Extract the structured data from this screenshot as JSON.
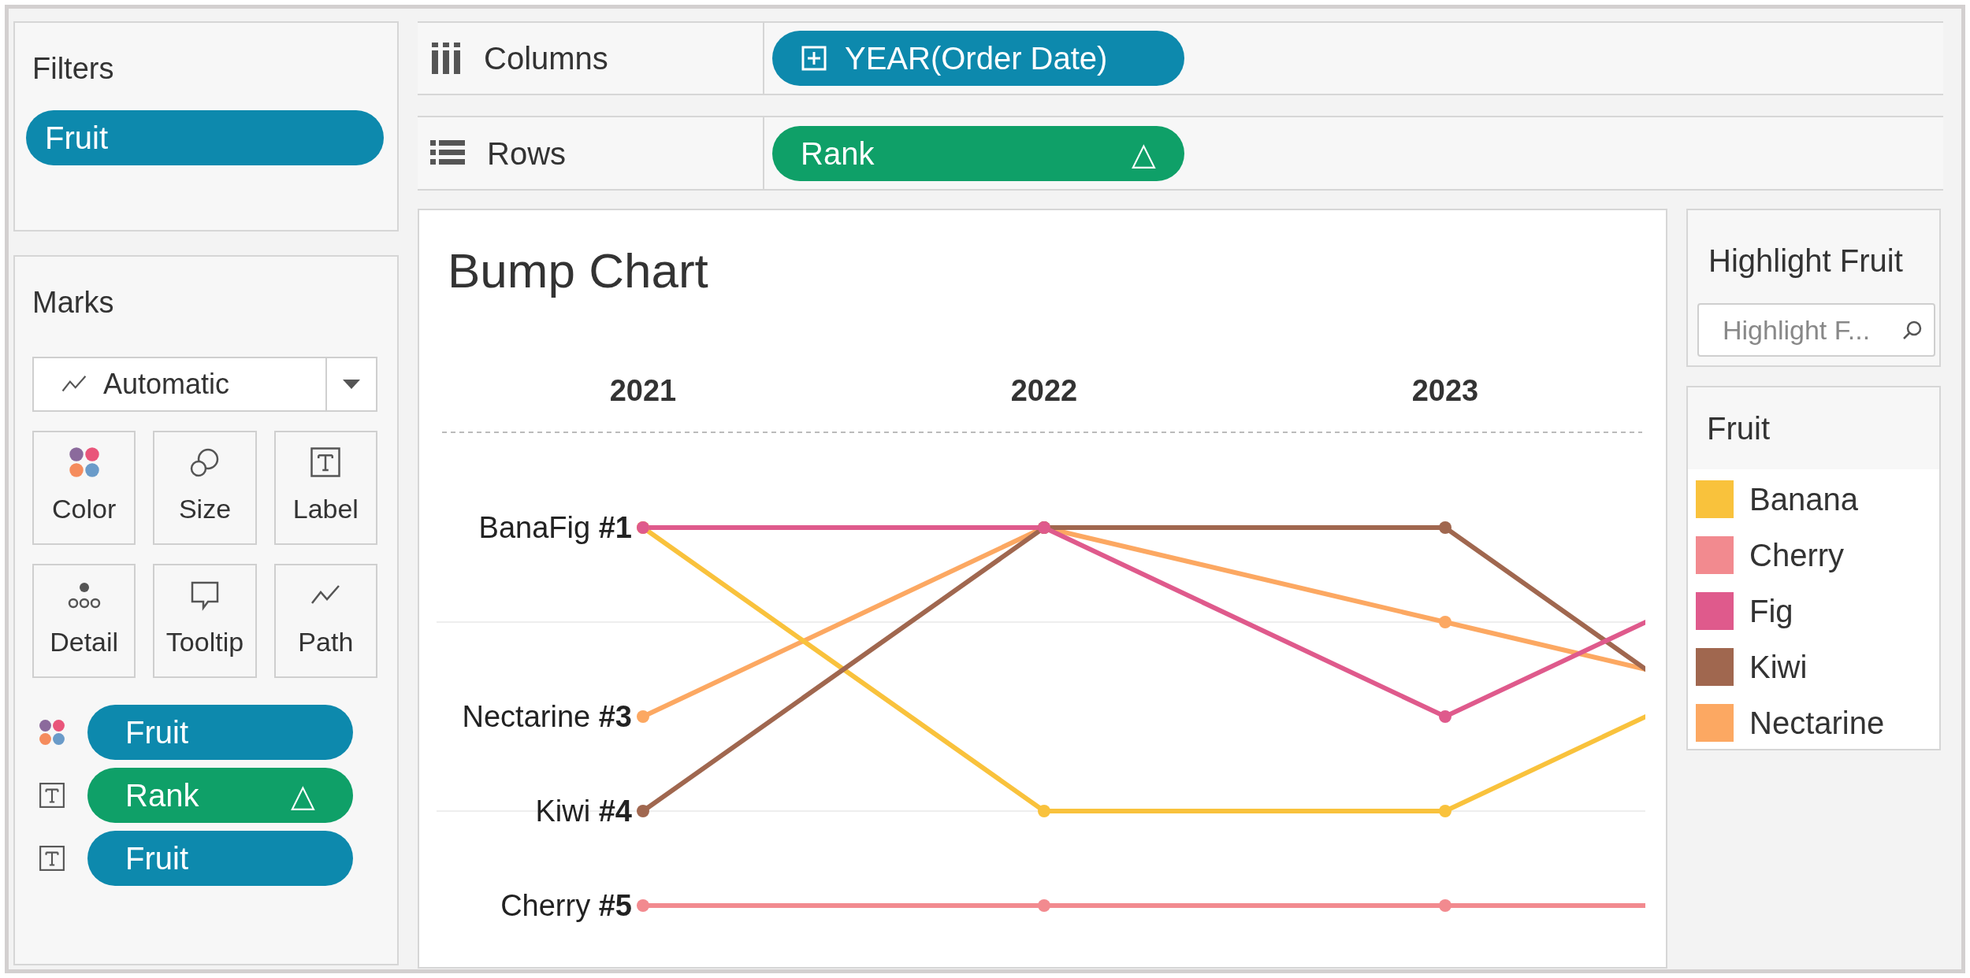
{
  "filters": {
    "title": "Filters",
    "pills": [
      {
        "label": "Fruit",
        "kind": "dimension"
      }
    ]
  },
  "marks": {
    "title": "Marks",
    "mark_type": "Automatic",
    "buttons": [
      {
        "label": "Color",
        "kind": "color"
      },
      {
        "label": "Size",
        "kind": "size"
      },
      {
        "label": "Label",
        "kind": "label"
      },
      {
        "label": "Detail",
        "kind": "detail"
      },
      {
        "label": "Tooltip",
        "kind": "tooltip"
      },
      {
        "label": "Path",
        "kind": "path"
      }
    ],
    "fields": [
      {
        "kind": "color_dimension",
        "label": "Fruit"
      },
      {
        "kind": "label_measure",
        "label": "Rank",
        "delta": "△"
      },
      {
        "kind": "label_dimension",
        "label": "Fruit"
      }
    ]
  },
  "columns_shelf": {
    "label": "Columns",
    "pills": [
      {
        "label": "YEAR(Order Date)",
        "kind": "dimension",
        "expandable": true
      }
    ]
  },
  "rows_shelf": {
    "label": "Rows",
    "pills": [
      {
        "label": "Rank",
        "kind": "measure",
        "delta": "△"
      }
    ]
  },
  "chart": {
    "title": "Bump Chart",
    "year_headers": [
      "2021",
      "2022",
      "2023"
    ],
    "label_rows": [
      [
        "Bana",
        "Fig **#1**"
      ],
      [
        "Nectarine **#3**"
      ],
      [
        "Kiwi **#4**"
      ],
      [
        "Cherry **#5**"
      ]
    ]
  },
  "highlighter": {
    "title": "Highlight Fruit",
    "placeholder": "Highlight F..."
  },
  "legend": {
    "title": "Fruit",
    "items": [
      {
        "label": "Banana",
        "color": "#f9c23c"
      },
      {
        "label": "Cherry",
        "color": "#f28a8f"
      },
      {
        "label": "Fig",
        "color": "#df5a8c"
      },
      {
        "label": "Kiwi",
        "color": "#a0674f"
      },
      {
        "label": "Nectarine",
        "color": "#fca862"
      }
    ]
  }
}
